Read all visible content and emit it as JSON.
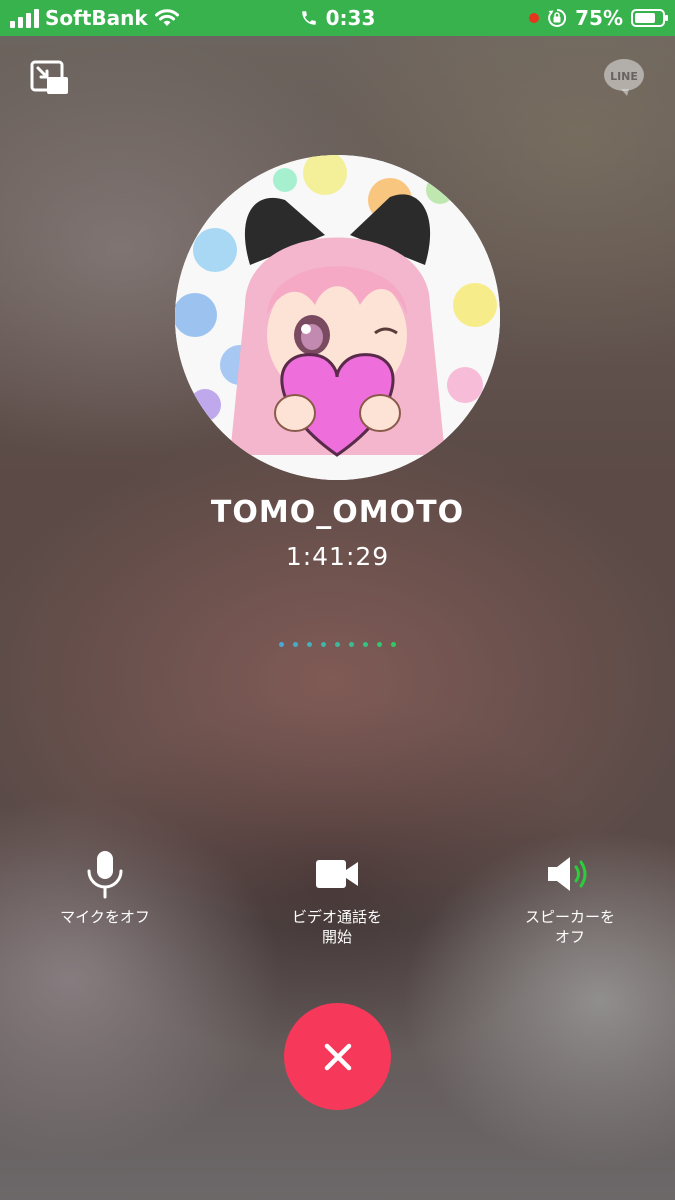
{
  "status_bar": {
    "carrier": "SoftBank",
    "time": "0:33",
    "battery_percent": "75%",
    "battery_level": 0.75,
    "signal_bars": 4,
    "icons": [
      "signal-icon",
      "wifi-icon",
      "phone-icon",
      "recording-dot-icon",
      "orientation-lock-icon",
      "battery-icon"
    ]
  },
  "top_bar": {
    "left_icon": "minimize-window-icon",
    "right_logo": "LINE"
  },
  "caller": {
    "name": "TOMO_OMOTO",
    "duration": "1:41:29",
    "avatar": "avatar-illustration"
  },
  "actions": [
    {
      "label": "マイクをオフ",
      "icon": "microphone-icon"
    },
    {
      "label": "ビデオ通話を\n開始",
      "icon": "video-camera-icon"
    },
    {
      "label": "スピーカーを\nオフ",
      "icon": "speaker-icon"
    }
  ],
  "end_call": {
    "icon": "close-icon"
  },
  "colors": {
    "status_bar": "#37b24d",
    "end_call": "#f6385a",
    "speaker_wave": "#2ccd3d",
    "dots_start": "#4aa7d6",
    "dots_end": "#2ecb64"
  }
}
